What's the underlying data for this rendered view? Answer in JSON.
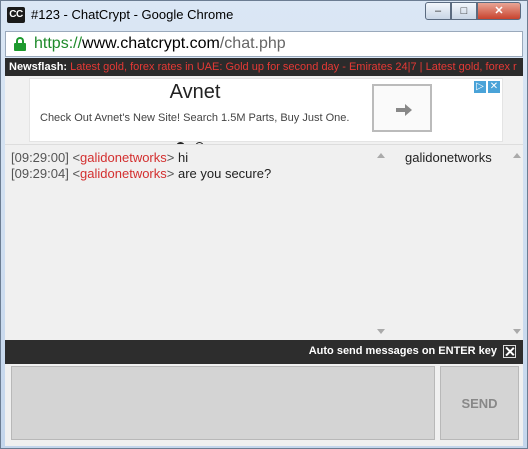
{
  "window": {
    "app_icon_text": "CC",
    "title": "#123 - ChatCrypt - Google Chrome",
    "minimize_glyph": "–",
    "maximize_glyph": "□",
    "close_glyph": "✕"
  },
  "address_bar": {
    "scheme": "https://",
    "domain": "www.chatcrypt.com",
    "path": "/chat.php",
    "secure_color": "#1e9a2e"
  },
  "newsflash": {
    "label": "Newsflash:",
    "text": "Latest gold, forex rates in UAE: Gold up for second day - Emirates 24|7 | Latest gold, forex r"
  },
  "ad": {
    "title": "Avnet",
    "description": "Check Out Avnet's New Site! Search 1.5M Parts, Buy Just One.",
    "adchoices_icons": [
      "play-icon",
      "close-icon"
    ],
    "adchoices_glyphs": [
      "▷",
      "✕"
    ],
    "carousel_active_index": 0,
    "carousel_count": 2
  },
  "chat": {
    "messages": [
      {
        "timestamp": "[09:29:00]",
        "nick": "galidonetworks",
        "text": "hi"
      },
      {
        "timestamp": "[09:29:04]",
        "nick": "galidonetworks",
        "text": "are you secure?"
      }
    ],
    "nick_open": "<",
    "nick_close": ">",
    "users": [
      "galidonetworks"
    ]
  },
  "options": {
    "auto_send_label": "Auto send messages on ENTER key",
    "auto_send_checked": true
  },
  "composer": {
    "input_value": "",
    "send_label": "SEND"
  },
  "colors": {
    "nick": "#d32f2f",
    "news_text": "#e53935",
    "dark_bar": "#2d2d2d"
  }
}
